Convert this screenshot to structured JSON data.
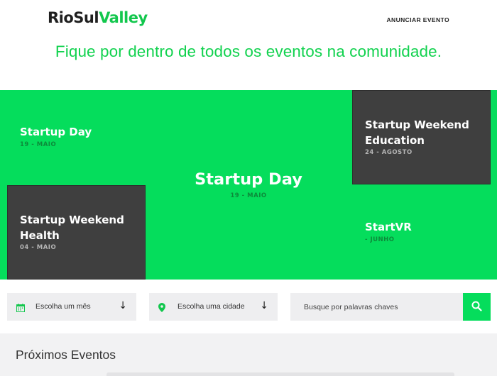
{
  "header": {
    "logo_part1": "RioSul",
    "logo_part2": "Valley",
    "nav_announce": "ANUNCIAR EVENTO"
  },
  "tagline": "Fique por dentro de todos os eventos na comunidade.",
  "hero": {
    "tiles": [
      {
        "title": "Startup Day",
        "date": "19 - MAIO",
        "style": "green"
      },
      {
        "title": "Startup Weekend Education",
        "title_line1": "Startup Weekend",
        "title_line2": "Education",
        "date": "24 - AGOSTO",
        "style": "dark"
      },
      {
        "title": "Startup Day",
        "date": "19 - MAIO",
        "style": "featured"
      },
      {
        "title": "Startup Weekend Health",
        "title_line1": "Startup Weekend",
        "title_line2": "Health",
        "date": "04 - MAIO",
        "style": "dark"
      },
      {
        "title": "StartVR",
        "date": "- JUNHO",
        "style": "green"
      }
    ]
  },
  "filters": {
    "month_label": "Escolha um mês",
    "city_label": "Escolha uma cidade",
    "search_placeholder": "Busque por palavras chaves",
    "arrow": "↓"
  },
  "upcoming": {
    "title": "Próximos Eventos"
  },
  "colors": {
    "brand_green": "#05dd5c",
    "dark_tile": "#3f3f3f",
    "filter_bg": "#eeeef0"
  },
  "icons": [
    "calendar-icon",
    "map-pin-icon",
    "arrow-down-icon",
    "search-icon"
  ]
}
